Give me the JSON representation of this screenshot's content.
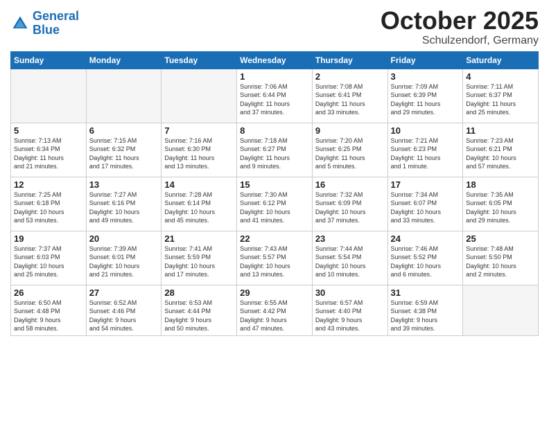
{
  "header": {
    "logo_general": "General",
    "logo_blue": "Blue",
    "month_title": "October 2025",
    "location": "Schulzendorf, Germany"
  },
  "days_of_week": [
    "Sunday",
    "Monday",
    "Tuesday",
    "Wednesday",
    "Thursday",
    "Friday",
    "Saturday"
  ],
  "weeks": [
    [
      {
        "day": "",
        "info": ""
      },
      {
        "day": "",
        "info": ""
      },
      {
        "day": "",
        "info": ""
      },
      {
        "day": "1",
        "info": "Sunrise: 7:06 AM\nSunset: 6:44 PM\nDaylight: 11 hours\nand 37 minutes."
      },
      {
        "day": "2",
        "info": "Sunrise: 7:08 AM\nSunset: 6:41 PM\nDaylight: 11 hours\nand 33 minutes."
      },
      {
        "day": "3",
        "info": "Sunrise: 7:09 AM\nSunset: 6:39 PM\nDaylight: 11 hours\nand 29 minutes."
      },
      {
        "day": "4",
        "info": "Sunrise: 7:11 AM\nSunset: 6:37 PM\nDaylight: 11 hours\nand 25 minutes."
      }
    ],
    [
      {
        "day": "5",
        "info": "Sunrise: 7:13 AM\nSunset: 6:34 PM\nDaylight: 11 hours\nand 21 minutes."
      },
      {
        "day": "6",
        "info": "Sunrise: 7:15 AM\nSunset: 6:32 PM\nDaylight: 11 hours\nand 17 minutes."
      },
      {
        "day": "7",
        "info": "Sunrise: 7:16 AM\nSunset: 6:30 PM\nDaylight: 11 hours\nand 13 minutes."
      },
      {
        "day": "8",
        "info": "Sunrise: 7:18 AM\nSunset: 6:27 PM\nDaylight: 11 hours\nand 9 minutes."
      },
      {
        "day": "9",
        "info": "Sunrise: 7:20 AM\nSunset: 6:25 PM\nDaylight: 11 hours\nand 5 minutes."
      },
      {
        "day": "10",
        "info": "Sunrise: 7:21 AM\nSunset: 6:23 PM\nDaylight: 11 hours\nand 1 minute."
      },
      {
        "day": "11",
        "info": "Sunrise: 7:23 AM\nSunset: 6:21 PM\nDaylight: 10 hours\nand 57 minutes."
      }
    ],
    [
      {
        "day": "12",
        "info": "Sunrise: 7:25 AM\nSunset: 6:18 PM\nDaylight: 10 hours\nand 53 minutes."
      },
      {
        "day": "13",
        "info": "Sunrise: 7:27 AM\nSunset: 6:16 PM\nDaylight: 10 hours\nand 49 minutes."
      },
      {
        "day": "14",
        "info": "Sunrise: 7:28 AM\nSunset: 6:14 PM\nDaylight: 10 hours\nand 45 minutes."
      },
      {
        "day": "15",
        "info": "Sunrise: 7:30 AM\nSunset: 6:12 PM\nDaylight: 10 hours\nand 41 minutes."
      },
      {
        "day": "16",
        "info": "Sunrise: 7:32 AM\nSunset: 6:09 PM\nDaylight: 10 hours\nand 37 minutes."
      },
      {
        "day": "17",
        "info": "Sunrise: 7:34 AM\nSunset: 6:07 PM\nDaylight: 10 hours\nand 33 minutes."
      },
      {
        "day": "18",
        "info": "Sunrise: 7:35 AM\nSunset: 6:05 PM\nDaylight: 10 hours\nand 29 minutes."
      }
    ],
    [
      {
        "day": "19",
        "info": "Sunrise: 7:37 AM\nSunset: 6:03 PM\nDaylight: 10 hours\nand 25 minutes."
      },
      {
        "day": "20",
        "info": "Sunrise: 7:39 AM\nSunset: 6:01 PM\nDaylight: 10 hours\nand 21 minutes."
      },
      {
        "day": "21",
        "info": "Sunrise: 7:41 AM\nSunset: 5:59 PM\nDaylight: 10 hours\nand 17 minutes."
      },
      {
        "day": "22",
        "info": "Sunrise: 7:43 AM\nSunset: 5:57 PM\nDaylight: 10 hours\nand 13 minutes."
      },
      {
        "day": "23",
        "info": "Sunrise: 7:44 AM\nSunset: 5:54 PM\nDaylight: 10 hours\nand 10 minutes."
      },
      {
        "day": "24",
        "info": "Sunrise: 7:46 AM\nSunset: 5:52 PM\nDaylight: 10 hours\nand 6 minutes."
      },
      {
        "day": "25",
        "info": "Sunrise: 7:48 AM\nSunset: 5:50 PM\nDaylight: 10 hours\nand 2 minutes."
      }
    ],
    [
      {
        "day": "26",
        "info": "Sunrise: 6:50 AM\nSunset: 4:48 PM\nDaylight: 9 hours\nand 58 minutes."
      },
      {
        "day": "27",
        "info": "Sunrise: 6:52 AM\nSunset: 4:46 PM\nDaylight: 9 hours\nand 54 minutes."
      },
      {
        "day": "28",
        "info": "Sunrise: 6:53 AM\nSunset: 4:44 PM\nDaylight: 9 hours\nand 50 minutes."
      },
      {
        "day": "29",
        "info": "Sunrise: 6:55 AM\nSunset: 4:42 PM\nDaylight: 9 hours\nand 47 minutes."
      },
      {
        "day": "30",
        "info": "Sunrise: 6:57 AM\nSunset: 4:40 PM\nDaylight: 9 hours\nand 43 minutes."
      },
      {
        "day": "31",
        "info": "Sunrise: 6:59 AM\nSunset: 4:38 PM\nDaylight: 9 hours\nand 39 minutes."
      },
      {
        "day": "",
        "info": ""
      }
    ]
  ]
}
